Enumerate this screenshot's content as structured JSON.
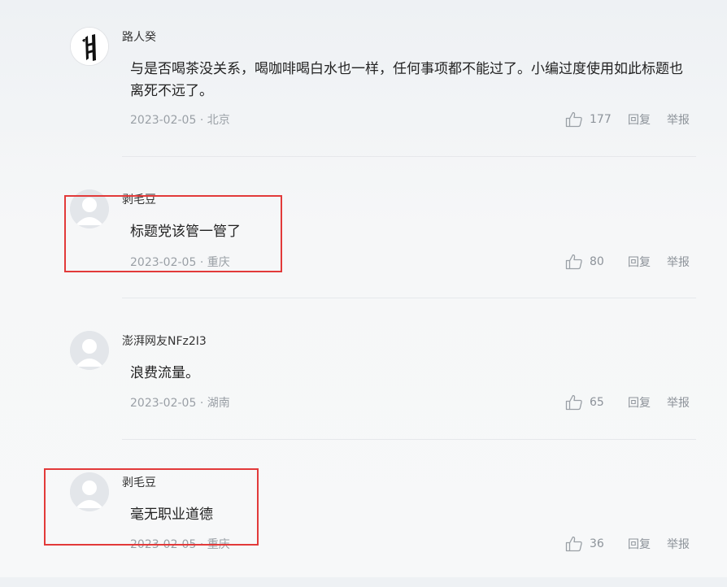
{
  "comments": [
    {
      "username": "路人癸",
      "avatar": "calligraphy-avatar",
      "content": "与是否喝茶没关系，喝咖啡喝白水也一样，任何事项都不能过了。小编过度使用如此标题也离死不远了。",
      "date": "2023-02-05",
      "location": "北京",
      "likes": "177",
      "reply_label": "回复",
      "report_label": "举报"
    },
    {
      "username": "剥毛豆",
      "avatar": "default-avatar",
      "content": "标题党该管一管了",
      "date": "2023-02-05",
      "location": "重庆",
      "likes": "80",
      "reply_label": "回复",
      "report_label": "举报"
    },
    {
      "username": "澎湃网友NFz2I3",
      "avatar": "default-avatar",
      "content": "浪费流量。",
      "date": "2023-02-05",
      "location": "湖南",
      "likes": "65",
      "reply_label": "回复",
      "report_label": "举报"
    },
    {
      "username": "剥毛豆",
      "avatar": "default-avatar",
      "content": "毫无职业道德",
      "date": "2023-02-05",
      "location": "重庆",
      "likes": "36",
      "reply_label": "回复",
      "report_label": "举报"
    }
  ],
  "meta_separator": " · ",
  "colors": {
    "highlight_border": "#e23a3a",
    "meta_text": "#9aa0a6",
    "divider": "#e6e8eb",
    "background": "#f7f8f9"
  }
}
